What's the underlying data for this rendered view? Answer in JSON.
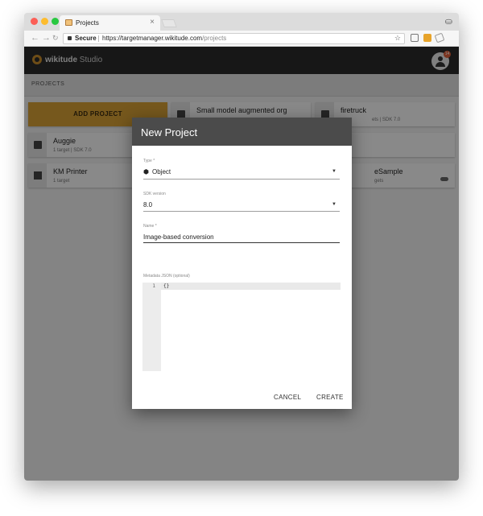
{
  "browser": {
    "tab_title": "Projects",
    "tab_close": "×",
    "secure_label": "Secure",
    "url_host": "https://targetmanager.wikitude.com",
    "url_path": "/projects",
    "star_icon": "☆",
    "incognito_icon": "⛀"
  },
  "app": {
    "logo_brand": "wikitude",
    "logo_product": "Studio",
    "notification_badge": "14",
    "section_title": "PROJECTS"
  },
  "projects": {
    "add_label": "ADD PROJECT",
    "items": [
      {
        "title": "Small model augmented org",
        "subtitle": "",
        "icon": "cube-icon"
      },
      {
        "title": "firetruck",
        "subtitle": "ets | SDK 7.0",
        "icon": "cube-icon"
      },
      {
        "title": "Auggie",
        "subtitle": "1 target | SDK 7.0",
        "icon": "cube-icon"
      },
      {
        "title": "KM Printer",
        "subtitle": "1 target",
        "icon": "image-icon"
      },
      {
        "title": "eSample",
        "subtitle": "gets",
        "icon": "cloud-icon"
      }
    ]
  },
  "dialog": {
    "title": "New Project",
    "type_label": "Type *",
    "type_value": "Object",
    "sdk_label": "SDK version",
    "sdk_value": "8.0",
    "name_label": "Name *",
    "name_value": "Image-based conversion",
    "metadata_label": "Metadata JSON (optional)",
    "editor_line_number": "1",
    "editor_code": "{}",
    "cancel_label": "CANCEL",
    "create_label": "CREATE"
  },
  "colors": {
    "accent": "#d8a136",
    "appbar": "#2b2b2b",
    "dialog_header": "#4b4b4b",
    "badge": "#e0603a"
  }
}
